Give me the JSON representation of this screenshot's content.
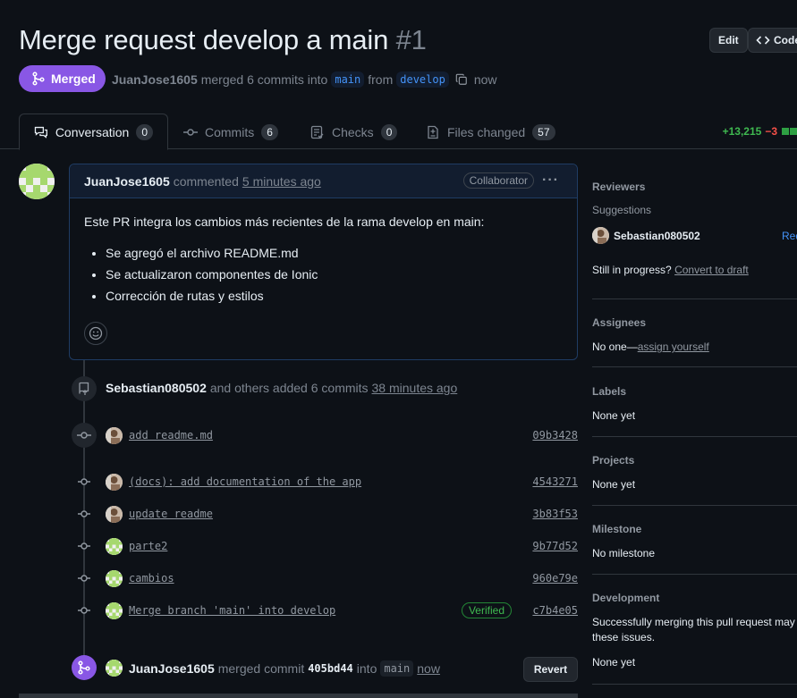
{
  "header": {
    "title": "Merge request develop a main",
    "number": "#1",
    "edit_label": "Edit",
    "code_label": "Code",
    "state_label": "Merged",
    "author": "JuanJose1605",
    "merged_text": "merged 6 commits into",
    "base_branch": "main",
    "from_text": "from",
    "head_branch": "develop",
    "time": "now"
  },
  "tabs": [
    {
      "label": "Conversation",
      "count": "0"
    },
    {
      "label": "Commits",
      "count": "6"
    },
    {
      "label": "Checks",
      "count": "0"
    },
    {
      "label": "Files changed",
      "count": "57"
    }
  ],
  "diffstat": {
    "additions": "+13,215",
    "deletions": "−3"
  },
  "comment": {
    "author": "JuanJose1605",
    "action": "commented",
    "time": "5 minutes ago",
    "role": "Collaborator",
    "menu": "···",
    "body_intro": "Este PR integra los cambios más recientes de la rama develop en main:",
    "bullets": [
      "Se agregó el archivo README.md",
      "Se actualizaron componentes de Ionic",
      "Corrección de rutas y estilos"
    ]
  },
  "timeline": {
    "commits_event": {
      "user": "Sebastian080502",
      "text": "and others added 6 commits",
      "time": "38 minutes ago"
    },
    "commits": [
      {
        "msg": "add readme.md",
        "sha": "09b3428",
        "avatar": "photo"
      },
      {
        "msg": "(docs): add documentation of the app",
        "sha": "4543271",
        "avatar": "photo"
      },
      {
        "msg": "update readme",
        "sha": "3b83f53",
        "avatar": "photo"
      },
      {
        "msg": "parte2",
        "sha": "9b77d52",
        "avatar": "identicon"
      },
      {
        "msg": "cambios",
        "sha": "960e79e",
        "avatar": "identicon"
      },
      {
        "msg": "Merge branch 'main' into develop",
        "sha": "c7b4e05",
        "avatar": "identicon",
        "verified": "Verified"
      }
    ],
    "merge_event": {
      "user": "JuanJose1605",
      "text": "merged commit",
      "commit": "405bd44",
      "into": "into",
      "branch": "main",
      "time": "now",
      "revert_label": "Revert"
    }
  },
  "sidebar": {
    "reviewers": {
      "heading": "Reviewers",
      "suggestions": "Suggestions",
      "suggested_user": "Sebastian080502",
      "request_label": "Req",
      "status": "Still in progress?",
      "draft_link": "Convert to draft"
    },
    "assignees": {
      "heading": "Assignees",
      "value": "No one—",
      "link": "assign yourself"
    },
    "labels": {
      "heading": "Labels",
      "value": "None yet"
    },
    "projects": {
      "heading": "Projects",
      "value": "None yet"
    },
    "milestone": {
      "heading": "Milestone",
      "value": "No milestone"
    },
    "development": {
      "heading": "Development",
      "line1": "Successfully merging this pull request may c",
      "line2": "these issues.",
      "value": "None yet"
    }
  },
  "colors": {
    "background": "#0d1117",
    "merged": "#8957e5",
    "link": "#4493f8",
    "additions": "#3fb950",
    "deletions": "#f85149"
  }
}
